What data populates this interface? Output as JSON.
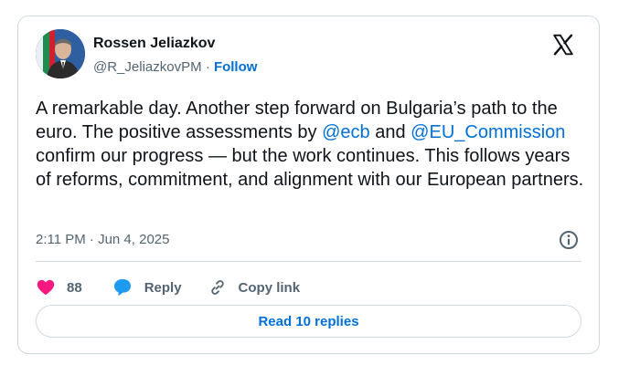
{
  "author": {
    "name": "Rossen Jeliazkov",
    "handle": "@R_JeliazkovPM",
    "separator": "·",
    "follow_label": "Follow"
  },
  "tweet": {
    "text_parts": [
      "A remarkable day. Another step forward on Bulgaria’s path to the euro. The positive assessments by ",
      " and ",
      " confirm our progress — but the work continues. This follows years of reforms, commitment, and alignment with our European partners."
    ],
    "mentions": [
      "@ecb",
      "@EU_Commission"
    ],
    "timestamp": "2:11 PM · Jun 4, 2025"
  },
  "actions": {
    "like_count": "88",
    "reply_label": "Reply",
    "copy_link_label": "Copy link"
  },
  "read_replies_label": "Read 10 replies",
  "icons": {
    "brand": "x-logo-icon",
    "like": "heart-icon",
    "reply": "speech-bubble-icon",
    "copy": "link-icon",
    "info": "info-icon"
  },
  "colors": {
    "link": "#006fd6",
    "heart": "#f91880",
    "reply_bubble": "#1d9bf0",
    "border": "#cfd9de",
    "muted": "#536471"
  }
}
